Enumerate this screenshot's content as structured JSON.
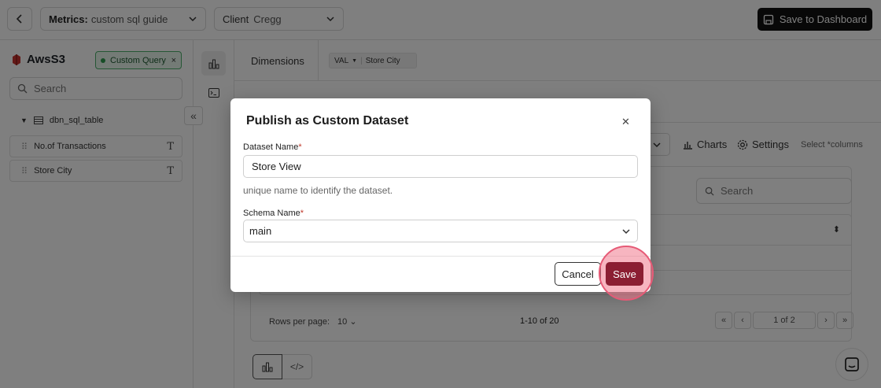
{
  "topbar": {
    "metrics_label": "Metrics:",
    "metrics_value": "custom sql guide",
    "client_label": "Client",
    "client_value": "Cregg",
    "save_dashboard": "Save to Dashboard"
  },
  "left_panel": {
    "source_name": "AwsS3",
    "badge": "Custom Query",
    "search_placeholder": "Search",
    "table_name": "dbn_sql_table",
    "columns": [
      {
        "name": "No.of Transactions",
        "type_icon": "T"
      },
      {
        "name": "Store City",
        "type_icon": "T"
      }
    ]
  },
  "main": {
    "dimensions_label": "Dimensions",
    "dimension_chip_prefix": "VAL",
    "dimension_chip_value": "Store City",
    "charts_label": "Charts",
    "settings_label": "Settings",
    "select_columns_hint": "Select *columns",
    "table_search_placeholder": "Search",
    "rows_per_page_label": "Rows per page:",
    "rows_per_page_value": "10",
    "range_text": "1-10 of 20",
    "page_text": "1 of 2"
  },
  "modal": {
    "title": "Publish as Custom Dataset",
    "dataset_name_label": "Dataset Name",
    "dataset_name_value": "Store View",
    "dataset_help": "unique name to identify the dataset.",
    "schema_name_label": "Schema Name",
    "schema_name_value": "main",
    "cancel_label": "Cancel",
    "save_label": "Save",
    "required_mark": "*"
  },
  "colors": {
    "save_button": "#8b1e32",
    "badge_green": "#2e9b4e",
    "highlight": "#e65a76"
  }
}
